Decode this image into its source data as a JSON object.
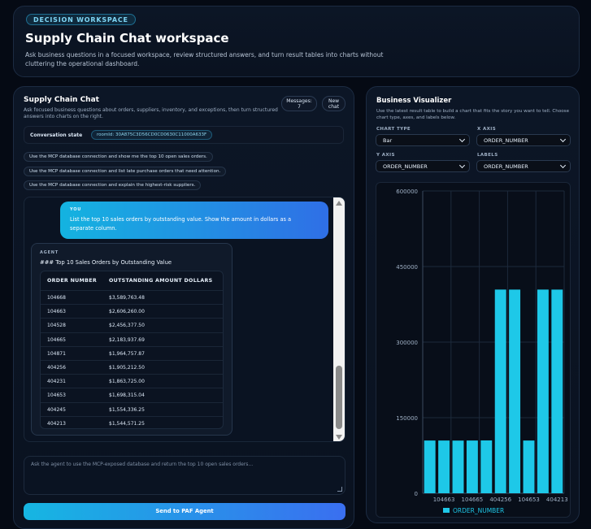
{
  "header": {
    "badge": "DECISION WORKSPACE",
    "title": "Supply Chain Chat workspace",
    "subtitle": "Ask business questions in a focused workspace, review structured answers, and turn result tables into charts without cluttering the operational dashboard."
  },
  "chat": {
    "title": "Supply Chain Chat",
    "description": "Ask focused business questions about orders, suppliers, inventory, and exceptions, then turn structured answers into charts on the right.",
    "messages_label": "Messages:",
    "messages_count": "7",
    "new_chat_line1": "New",
    "new_chat_line2": "chat",
    "conversation_label": "Conversation state",
    "conversation_id": "roomId: 30A875C3D56CD0CD0630C11000A633F",
    "suggestions": [
      "Use the MCP database connection and show me the top 10 open sales orders.",
      "Use the MCP database connection and list late purchase orders that need attention.",
      "Use the MCP database connection and explain the highest-risk suppliers."
    ],
    "user_message": {
      "role": "YOU",
      "text": "List the top 10 sales orders by outstanding value. Show the amount in dollars as a separate column."
    },
    "agent_message": {
      "role": "AGENT",
      "heading": "### Top 10 Sales Orders by Outstanding Value",
      "columns": [
        "ORDER NUMBER",
        "OUTSTANDING AMOUNT DOLLARS"
      ],
      "rows": [
        [
          "104668",
          "$3,589,763.48"
        ],
        [
          "104663",
          "$2,606,260.00"
        ],
        [
          "104528",
          "$2,456,377.50"
        ],
        [
          "104665",
          "$2,183,937.69"
        ],
        [
          "104871",
          "$1,964,757.87"
        ],
        [
          "404256",
          "$1,905,212.50"
        ],
        [
          "404231",
          "$1,863,725.00"
        ],
        [
          "104653",
          "$1,698,315.04"
        ],
        [
          "404245",
          "$1,554,336.25"
        ],
        [
          "404213",
          "$1,544,571.25"
        ]
      ]
    },
    "composer_placeholder": "Ask the agent to use the MCP-exposed database and return the top 10 open sales orders...",
    "send_label": "Send to PAF Agent"
  },
  "visualizer": {
    "title": "Business Visualizer",
    "description": "Use the latest result table to build a chart that fits the story you want to tell. Choose chart type, axes, and labels below.",
    "chart_type_label": "CHART TYPE",
    "chart_type_value": "Bar",
    "x_axis_label": "X AXIS",
    "x_axis_value": "ORDER_NUMBER",
    "y_axis_label": "Y AXIS",
    "y_axis_value": "ORDER_NUMBER",
    "labels_label": "LABELS",
    "labels_value": "ORDER_NUMBER"
  },
  "colors": {
    "accent": "#1ec8e8",
    "bar": "#1ec8e8",
    "gradient_start": "#16b6e2",
    "gradient_end": "#3a6ff0"
  },
  "chart_data": {
    "type": "bar",
    "categories": [
      "104668",
      "104663",
      "104528",
      "104665",
      "104871",
      "404256",
      "404231",
      "104653",
      "404245",
      "404213"
    ],
    "tick_labels_shown": [
      "104663",
      "104665",
      "404256",
      "104653",
      "404213"
    ],
    "series": [
      {
        "name": "ORDER_NUMBER",
        "values": [
          104668,
          104663,
          104528,
          104665,
          104871,
          404256,
          404231,
          104653,
          404245,
          404213
        ]
      }
    ],
    "y_ticks": [
      "0",
      "150000",
      "300000",
      "450000",
      "600000"
    ],
    "ylim": [
      0,
      600000
    ],
    "grid": true,
    "legend": "bottom"
  }
}
